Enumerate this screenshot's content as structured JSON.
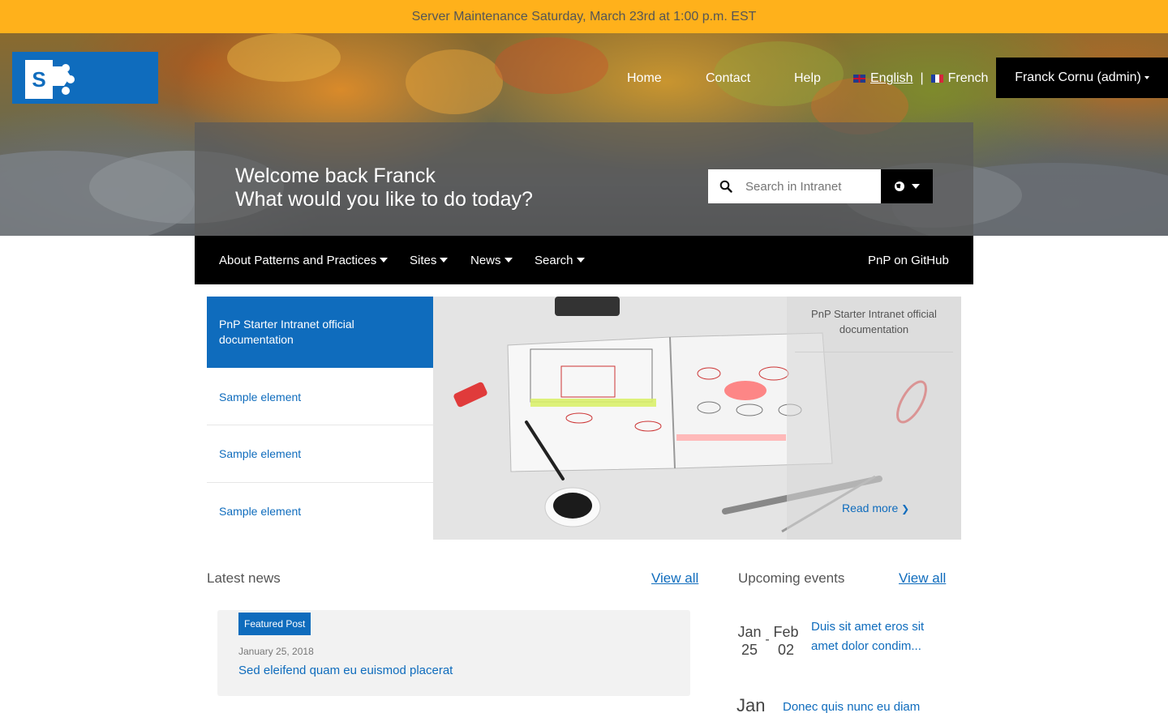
{
  "banner": {
    "text": "Server Maintenance Saturday, March 23rd at 1:00 p.m. EST"
  },
  "header": {
    "logo": "sharepoint-logo",
    "nav": [
      "Home",
      "Contact",
      "Help"
    ],
    "languages": {
      "english": "English",
      "separator": "|",
      "french": "French",
      "active": "English"
    },
    "user": "Franck Cornu (admin)"
  },
  "welcome": {
    "line1": "Welcome back Franck",
    "line2": "What would you like to do today?"
  },
  "search": {
    "placeholder": "Search in Intranet",
    "scope_icon": "globe-icon"
  },
  "mainnav": {
    "items": [
      "About Patterns and Practices",
      "Sites",
      "News",
      "Search"
    ],
    "github": "PnP on GitHub"
  },
  "carousel": {
    "items": [
      "PnP Starter Intranet official documentation",
      "Sample element",
      "Sample element",
      "Sample element"
    ],
    "caption_title": "PnP Starter Intranet official documentation",
    "read_more": "Read more"
  },
  "news": {
    "title": "Latest news",
    "view_all": "View all",
    "featured_badge": "Featured Post",
    "post_date": "January 25, 2018",
    "post_title": "Sed eleifend quam eu euismod placerat"
  },
  "events": {
    "title": "Upcoming events",
    "view_all": "View all",
    "items": [
      {
        "start_month": "Jan",
        "start_day": "25",
        "dash": "-",
        "end_month": "Feb",
        "end_day": "02",
        "title": "Duis sit amet eros sit amet dolor condim..."
      },
      {
        "start_month": "Jan",
        "title": "Donec quis nunc eu diam"
      }
    ]
  },
  "colors": {
    "banner": "#ffb11b",
    "accent": "#0f6cbd",
    "nav": "#000000"
  }
}
